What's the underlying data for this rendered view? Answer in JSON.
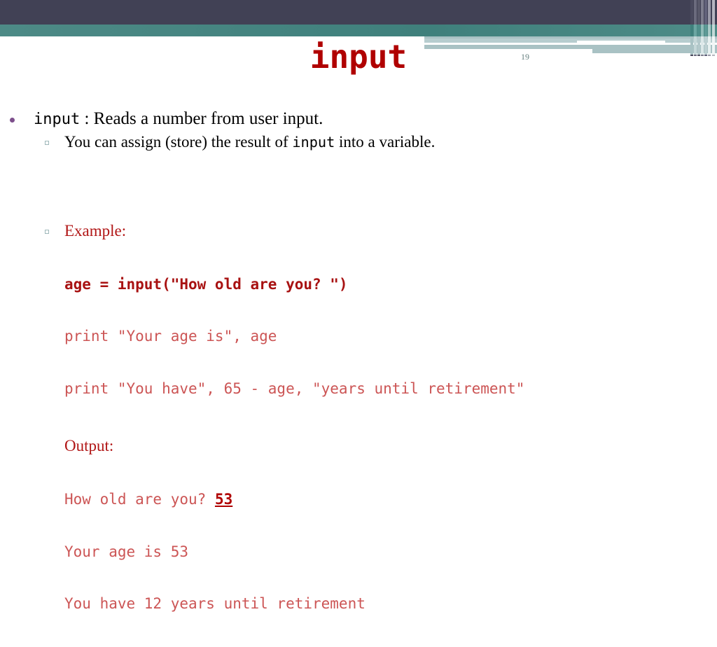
{
  "slide": {
    "title": "input",
    "page_number": "19",
    "colors": {
      "header_dark": "#414155",
      "header_teal": "#41837f",
      "header_pale": "#a9c2c4",
      "title_red": "#b00000",
      "code_red_bold": "#a81212",
      "code_red_plain": "#cc5555",
      "bullet_purple": "#7d4f8c"
    }
  },
  "body": {
    "bullet1": {
      "code_term": "input",
      "text": " : Reads a number from user input."
    },
    "bullet2": {
      "text_before": "You can assign (store) the result of ",
      "code_term": "input",
      "text_after": " into a variable."
    },
    "example": {
      "label": "Example:",
      "code_lines": [
        {
          "text": "age = input(\"How old are you? \")",
          "bold": true
        },
        {
          "text": "print \"Your age is\", age",
          "bold": false
        },
        {
          "text": "print \"You have\", 65 - age, \"years until retirement\"",
          "bold": false
        }
      ],
      "output_label": "Output:",
      "output_lines": [
        {
          "prompt": "How old are you? ",
          "answer": "53"
        },
        {
          "text": "Your age is 53"
        },
        {
          "text": "You have 12 years until retirement"
        }
      ]
    }
  }
}
